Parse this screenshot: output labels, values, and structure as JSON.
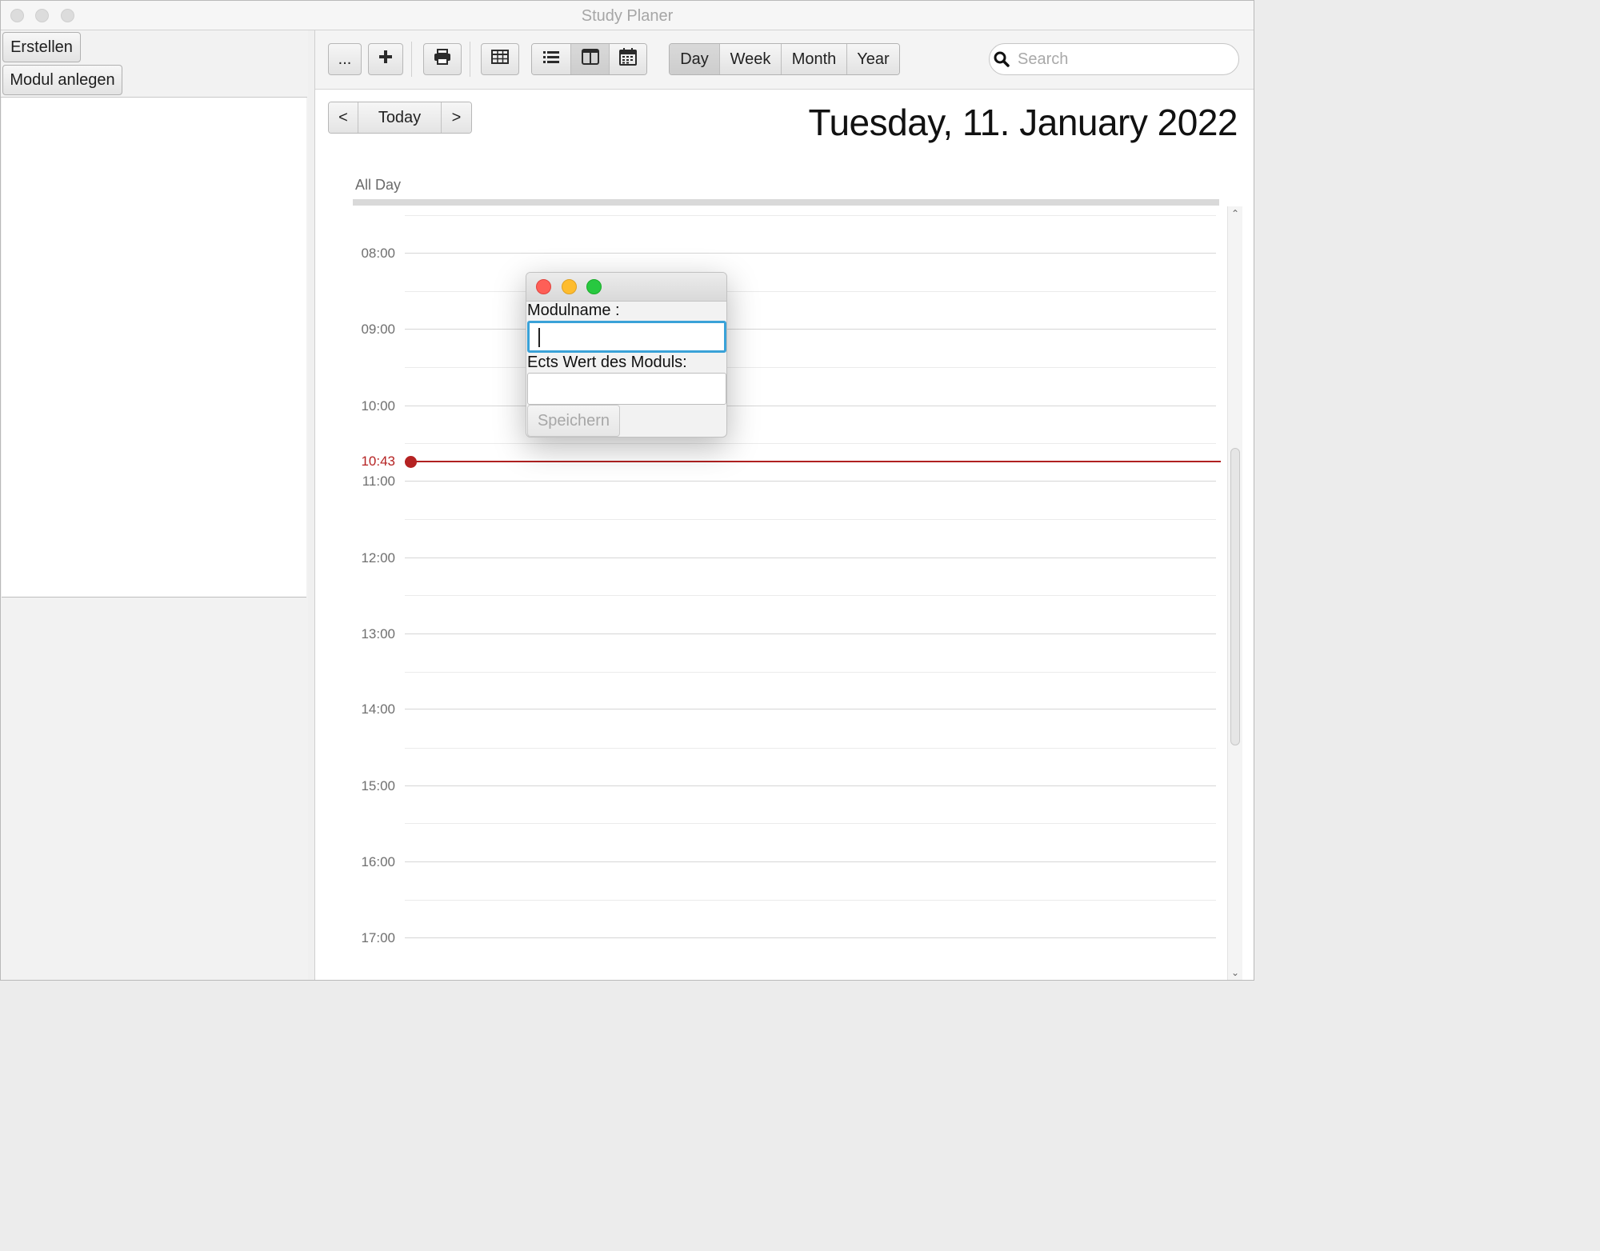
{
  "window": {
    "title": "Study Planer"
  },
  "sidebar": {
    "create_label": "Erstellen",
    "add_module_label": "Modul anlegen"
  },
  "toolbar": {
    "more_label": "...",
    "add_icon": "plus-icon",
    "print_icon": "printer-icon",
    "view_buttons": [
      "table-icon",
      "list-icon",
      "columns-icon",
      "calendar-icon"
    ],
    "range_tabs": [
      "Day",
      "Week",
      "Month",
      "Year"
    ],
    "selected_range": "Day",
    "search_placeholder": "Search"
  },
  "navigation": {
    "prev_label": "<",
    "today_label": "Today",
    "next_label": ">"
  },
  "day_view": {
    "date_title": "Tuesday, 11. January 2022",
    "all_day_label": "All Day",
    "hours": [
      "08:00",
      "09:00",
      "10:00",
      "11:00",
      "12:00",
      "13:00",
      "14:00",
      "15:00",
      "16:00",
      "17:00"
    ],
    "current_time": "10:43",
    "current_time_color": "#b52222"
  },
  "dialog": {
    "module_name_label": "Modulname :",
    "module_name_value": "",
    "ects_label": "Ects Wert des Moduls:",
    "ects_value": "",
    "save_label": "Speichern",
    "close_color": "#fe5f57",
    "minimize_color": "#febc2e",
    "maximize_color": "#28c840"
  }
}
